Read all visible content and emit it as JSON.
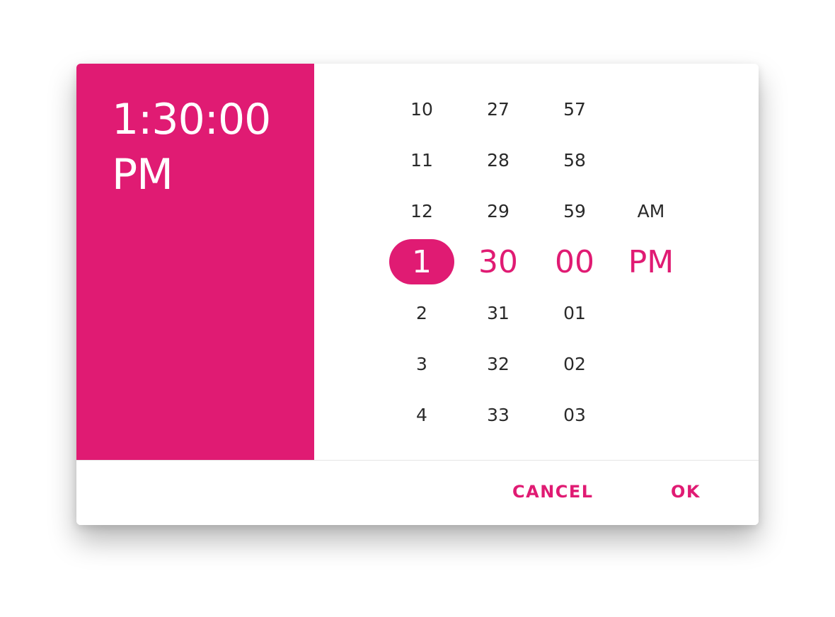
{
  "colors": {
    "accent": "#e01b73",
    "text": "#2a2a2a",
    "surface": "#ffffff"
  },
  "header": {
    "time": "1:30:00",
    "period": "PM"
  },
  "columns": {
    "hours": {
      "items": [
        "10",
        "11",
        "12",
        "1",
        "2",
        "3",
        "4"
      ],
      "selected": "1"
    },
    "minutes": {
      "items": [
        "27",
        "28",
        "29",
        "30",
        "31",
        "32",
        "33"
      ],
      "selected": "30"
    },
    "seconds": {
      "items": [
        "57",
        "58",
        "59",
        "00",
        "01",
        "02",
        "03"
      ],
      "selected": "00"
    },
    "period": {
      "items": [
        "",
        "",
        "AM",
        "PM",
        "",
        "",
        ""
      ],
      "selected": "PM"
    }
  },
  "footer": {
    "cancel_label": "CANCEL",
    "ok_label": "OK"
  }
}
